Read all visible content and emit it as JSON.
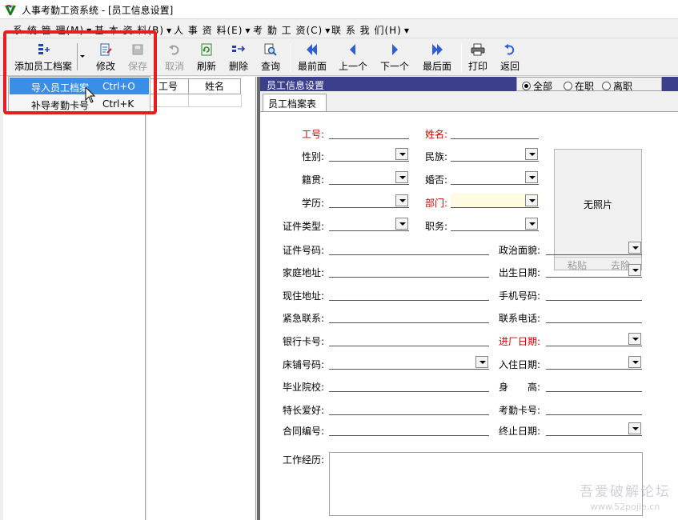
{
  "window": {
    "title": "人事考勤工资系统 - [员工信息设置]"
  },
  "menu": [
    {
      "label": "系 统 管 理(M)"
    },
    {
      "label": "基 本 资 料(B)"
    },
    {
      "label": "人 事 资 料(E)"
    },
    {
      "label": "考 勤 工 资(C)"
    },
    {
      "label": "联 系 我 们(H)"
    }
  ],
  "toolbar": {
    "add": "添加员工档案",
    "edit": "修改",
    "save": "保存",
    "cancel": "取消",
    "refresh": "刷新",
    "delete": "删除",
    "query": "查询",
    "first": "最前面",
    "prev": "上一个",
    "next": "下一个",
    "last": "最后面",
    "print": "打印",
    "back": "返回"
  },
  "dropdown": [
    {
      "label": "导入员工档案",
      "shortcut": "Ctrl+O"
    },
    {
      "label": "补导考勤卡号",
      "shortcut": "Ctrl+K"
    }
  ],
  "list": {
    "col_id": "工号",
    "col_name": "姓名"
  },
  "panel": {
    "title": "员工信息设置",
    "radio_all": "全部",
    "radio_active": "在职",
    "radio_left": "离职",
    "tab": "员工档案表"
  },
  "form": {
    "emp_no": "工号:",
    "name": "姓名:",
    "gender": "性别:",
    "ethnicity": "民族:",
    "origin": "籍贯:",
    "marital": "婚否:",
    "education": "学历:",
    "department": "部门:",
    "id_type": "证件类型:",
    "position": "职务:",
    "id_no": "证件号码:",
    "political": "政治面貌:",
    "home_addr": "家庭地址:",
    "birth": "出生日期:",
    "cur_addr": "现住地址:",
    "mobile": "手机号码:",
    "emergency": "紧急联系:",
    "phone": "联系电话:",
    "bank": "银行卡号:",
    "join_date": "进厂日期:",
    "bed": "床铺号码:",
    "checkin": "入住日期:",
    "school": "毕业院校:",
    "height": "身　　高:",
    "hobby": "特长爱好:",
    "attend_card": "考勤卡号:",
    "contract": "合同编号:",
    "end_date": "终止日期:",
    "work_exp": "工作经历:"
  },
  "photo": {
    "placeholder": "无照片",
    "paste": "粘贴",
    "remove": "去除"
  },
  "watermark": {
    "line1": "吾爱破解论坛",
    "line2": "www.52pojie.cn"
  }
}
